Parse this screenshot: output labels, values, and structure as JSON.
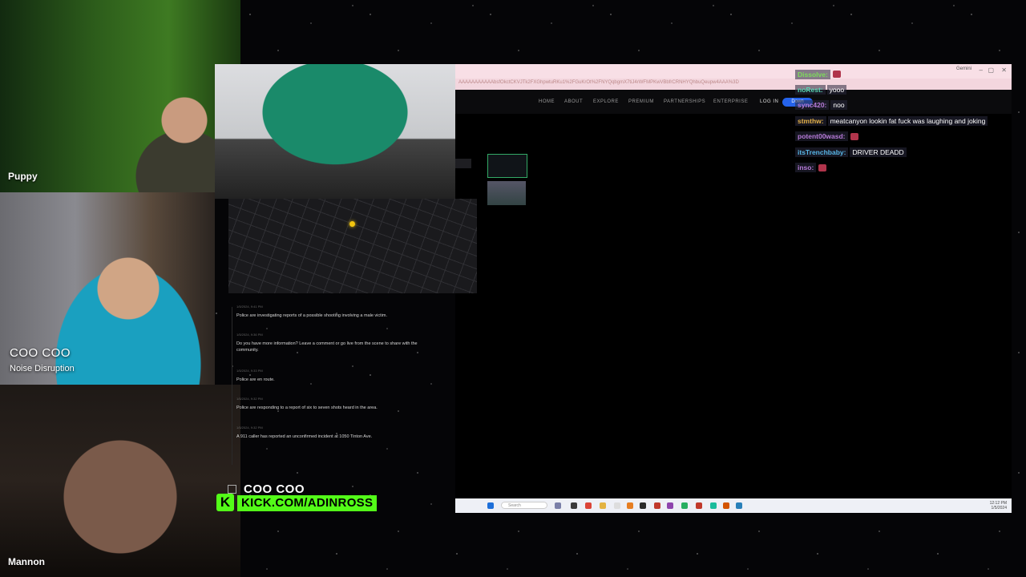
{
  "cams": {
    "puppy": "Puppy",
    "coo_name": "COO COO",
    "coo_sub": "Noise Disruption",
    "mannon": "Mannon"
  },
  "site": {
    "address": "AAAAAAAAAAAbsfOkctCKVJTk2FXGhpwtuRKu1%2FGuKrOt%2FNYQqbgmX7tiJ4rWFMPKwVBbfrCRNHYQhbuQeupw4AAA%3D",
    "profile": "Gemini",
    "nav": [
      "HOME",
      "ABOUT",
      "EXPLORE",
      "PREMIUM",
      "PARTNERSHIPS",
      "ENTERPRISE",
      "LOG IN"
    ],
    "download": "Down"
  },
  "feed": [
    {
      "time": "1/5/2024, 9:41 PM",
      "text": "Police are investigating reports of a possible shooting involving a male victim."
    },
    {
      "time": "1/5/2024, 9:36 PM",
      "text": "Do you have more information? Leave a comment or go live from the scene to share with the community."
    },
    {
      "time": "1/5/2024, 9:33 PM",
      "text": "Police are en route."
    },
    {
      "time": "1/5/2024, 9:32 PM",
      "text": "Police are responding to a report of six to seven shots heard in the area."
    },
    {
      "time": "1/5/2024, 9:32 PM",
      "text": "A 911 caller has reported an unconfirmed incident at 1050 Tinton Ave."
    }
  ],
  "chat": [
    {
      "user": "Dissolve:",
      "msg": "",
      "color": "#7ddc5a",
      "emote": true
    },
    {
      "user": "noRest:",
      "msg": "yooo",
      "color": "#58d6b4",
      "emote": false
    },
    {
      "user": "sync420:",
      "msg": "noo",
      "color": "#b77bd9",
      "emote": false
    },
    {
      "user": "stmthw:",
      "msg": "meatcanyon lookin fat fuck was laughing and joking",
      "color": "#e6b34a",
      "emote": false
    },
    {
      "user": "potent00wasd:",
      "msg": "",
      "color": "#b77bd9",
      "emote": true
    },
    {
      "user": "itsTrenchbaby:",
      "msg": "DRIVER DEADD",
      "color": "#58b6e6",
      "emote": false
    },
    {
      "user": "inso:",
      "msg": "",
      "color": "#b77bd9",
      "emote": true
    }
  ],
  "taskbar": {
    "search": "Search",
    "time": "12:12 PM",
    "date": "1/5/2024"
  },
  "overlay": {
    "name": "COO COO",
    "logo": "K",
    "url": "KICK.COM/ADINROSS"
  },
  "colors": {
    "kick_green": "#53fc18",
    "accent_blue": "#2563eb"
  }
}
